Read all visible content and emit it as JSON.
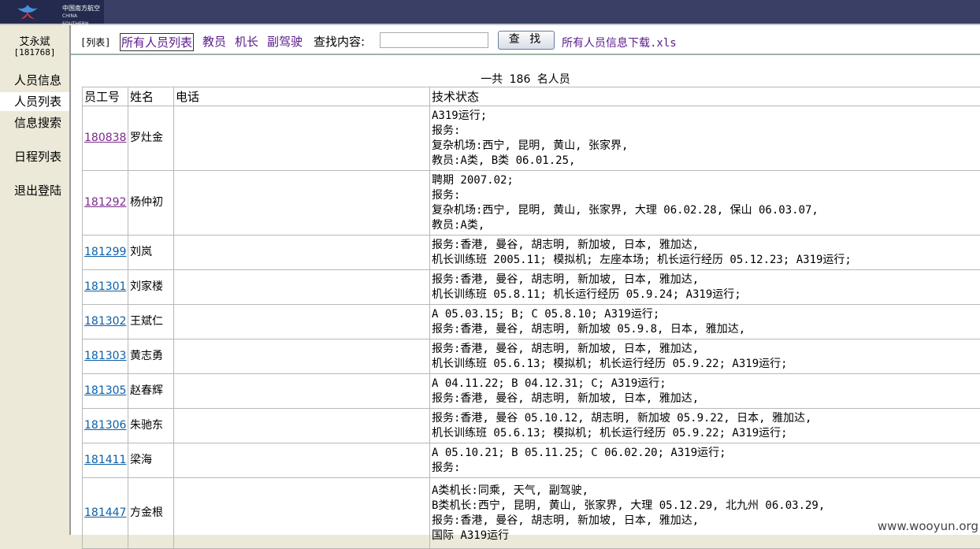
{
  "header": {
    "logo_cn": "中国南方航空",
    "logo_en": "CHINA SOUTHERN",
    "colors": {
      "bar": "#3a3f66",
      "logo_bg": "#232a4e"
    }
  },
  "user": {
    "name": "艾永斌",
    "id": "[181768]"
  },
  "nav": [
    "人员信息",
    "人员列表",
    "信息搜索",
    "日程列表",
    "退出登陆"
  ],
  "toolbar": {
    "tag": "[列表]",
    "links": [
      "所有人员列表",
      "教员",
      "机长",
      "副驾驶"
    ],
    "search_label": "查找内容:",
    "search_value": "",
    "search_button": "查 找",
    "download": "所有人员信息下载.xls"
  },
  "summary": {
    "prefix": "一共",
    "count": "186",
    "suffix": "名人员"
  },
  "table": {
    "headers": [
      "员工号",
      "姓名",
      "电话",
      "技术状态"
    ],
    "rows": [
      {
        "id": "180838",
        "name": "罗灶金",
        "phone": "",
        "visited": true,
        "status": [
          "A319运行;",
          "报务:",
          "复杂机场:西宁, 昆明, 黄山, 张家界,",
          "教员:A类, B类 06.01.25,"
        ]
      },
      {
        "id": "181292",
        "name": "杨仲初",
        "phone": "",
        "visited": true,
        "status": [
          "聘期 2007.02;",
          "报务:",
          "复杂机场:西宁, 昆明, 黄山, 张家界, 大理 06.02.28, 保山 06.03.07,",
          "教员:A类,"
        ]
      },
      {
        "id": "181299",
        "name": "刘岚",
        "phone": "",
        "visited": false,
        "status": [
          "报务:香港, 曼谷, 胡志明, 新加坡, 日本, 雅加达,",
          "机长训练班 2005.11; 模拟机; 左座本场; 机长运行经历 05.12.23; A319运行;"
        ]
      },
      {
        "id": "181301",
        "name": "刘家楼",
        "phone": "",
        "visited": false,
        "status": [
          "报务:香港, 曼谷, 胡志明, 新加坡, 日本, 雅加达,",
          "机长训练班 05.8.11; 机长运行经历 05.9.24; A319运行;"
        ]
      },
      {
        "id": "181302",
        "name": "王斌仁",
        "phone": "",
        "visited": false,
        "status": [
          "A 05.03.15; B; C 05.8.10; A319运行;",
          "报务:香港, 曼谷, 胡志明, 新加坡 05.9.8, 日本, 雅加达,"
        ]
      },
      {
        "id": "181303",
        "name": "黄志勇",
        "phone": "",
        "visited": false,
        "status": [
          "报务:香港, 曼谷, 胡志明, 新加坡, 日本, 雅加达,",
          "机长训练班 05.6.13; 模拟机; 机长运行经历 05.9.22; A319运行;"
        ]
      },
      {
        "id": "181305",
        "name": "赵春辉",
        "phone": "",
        "visited": false,
        "status": [
          "A 04.11.22; B 04.12.31; C; A319运行;",
          "报务:香港, 曼谷, 胡志明, 新加坡, 日本, 雅加达,"
        ]
      },
      {
        "id": "181306",
        "name": "朱驰东",
        "phone": "",
        "visited": false,
        "status": [
          "报务:香港, 曼谷 05.10.12, 胡志明, 新加坡 05.9.22, 日本, 雅加达,",
          "机长训练班 05.6.13; 模拟机; 机长运行经历 05.9.22; A319运行;"
        ]
      },
      {
        "id": "181411",
        "name": "梁海",
        "phone": "",
        "visited": false,
        "status": [
          "A 05.10.21; B 05.11.25; C 06.02.20; A319运行;",
          "报务:"
        ]
      },
      {
        "id": "181447",
        "name": "方金根",
        "phone": "",
        "visited": false,
        "status": [
          "A类机长:同乘, 天气, 副驾驶,",
          "B类机长:西宁, 昆明, 黄山, 张家界, 大理 05.12.29, 北九州 06.03.29,",
          "报务:香港, 曼谷, 胡志明, 新加坡, 日本, 雅加达,",
          "国际 A319运行"
        ]
      }
    ]
  },
  "watermark": "www.wooyun.org"
}
